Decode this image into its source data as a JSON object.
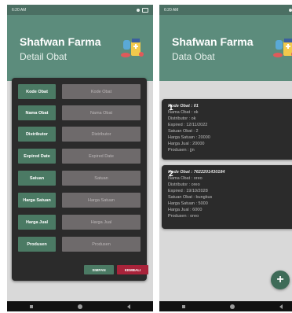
{
  "left": {
    "status_time": "6:20 AM",
    "app_title": "Shafwan Farma",
    "subtitle": "Detail Obat",
    "fields": [
      {
        "label": "Kode Obat",
        "placeholder": "Kode Obat"
      },
      {
        "label": "Nama Obat",
        "placeholder": "Nama Obat"
      },
      {
        "label": "Distributor",
        "placeholder": "Distributor"
      },
      {
        "label": "Expired Date",
        "placeholder": "Expired Date"
      },
      {
        "label": "Satuan",
        "placeholder": "Satuan"
      },
      {
        "label": "Harga Satuan",
        "placeholder": "Harga Satuan"
      },
      {
        "label": "Harga Jual",
        "placeholder": "Harga Jual"
      },
      {
        "label": "Produsen",
        "placeholder": "Produsen"
      }
    ],
    "save_label": "SIMPAN",
    "back_label": "KEMBALI"
  },
  "right": {
    "status_time": "6:20 AM",
    "app_title": "Shafwan Farma",
    "subtitle": "Data Obat",
    "cards": [
      {
        "number": "1",
        "lines": [
          "Kode Obat : 01",
          "Nama Obat : ok",
          "Distributor : ok",
          "Expired : 12/11/2022",
          "Satuan Obat : 2",
          "Harga Satuan : 20000",
          "Harga Jual : 20000",
          "Produsen : jjn"
        ]
      },
      {
        "number": "2",
        "lines": [
          "Kode Obat : 7622201430184",
          "Nama Obat : oreo",
          "Distributor : oreo",
          "Expired : 19/10/2028",
          "Satuan Obat : bungkus",
          "Harga Satuan : 5000",
          "Harga Jual : 6000",
          "Produsen : oreo"
        ]
      }
    ],
    "fab_label": "+"
  },
  "icons": [
    "pharmacy-logo-icon",
    "wifi-icon",
    "battery-icon",
    "add-icon"
  ],
  "colors": {
    "header": "#5c8c7c",
    "label_green": "#4b7a64",
    "danger": "#a8233a",
    "card_dark": "#2b2b2b"
  }
}
